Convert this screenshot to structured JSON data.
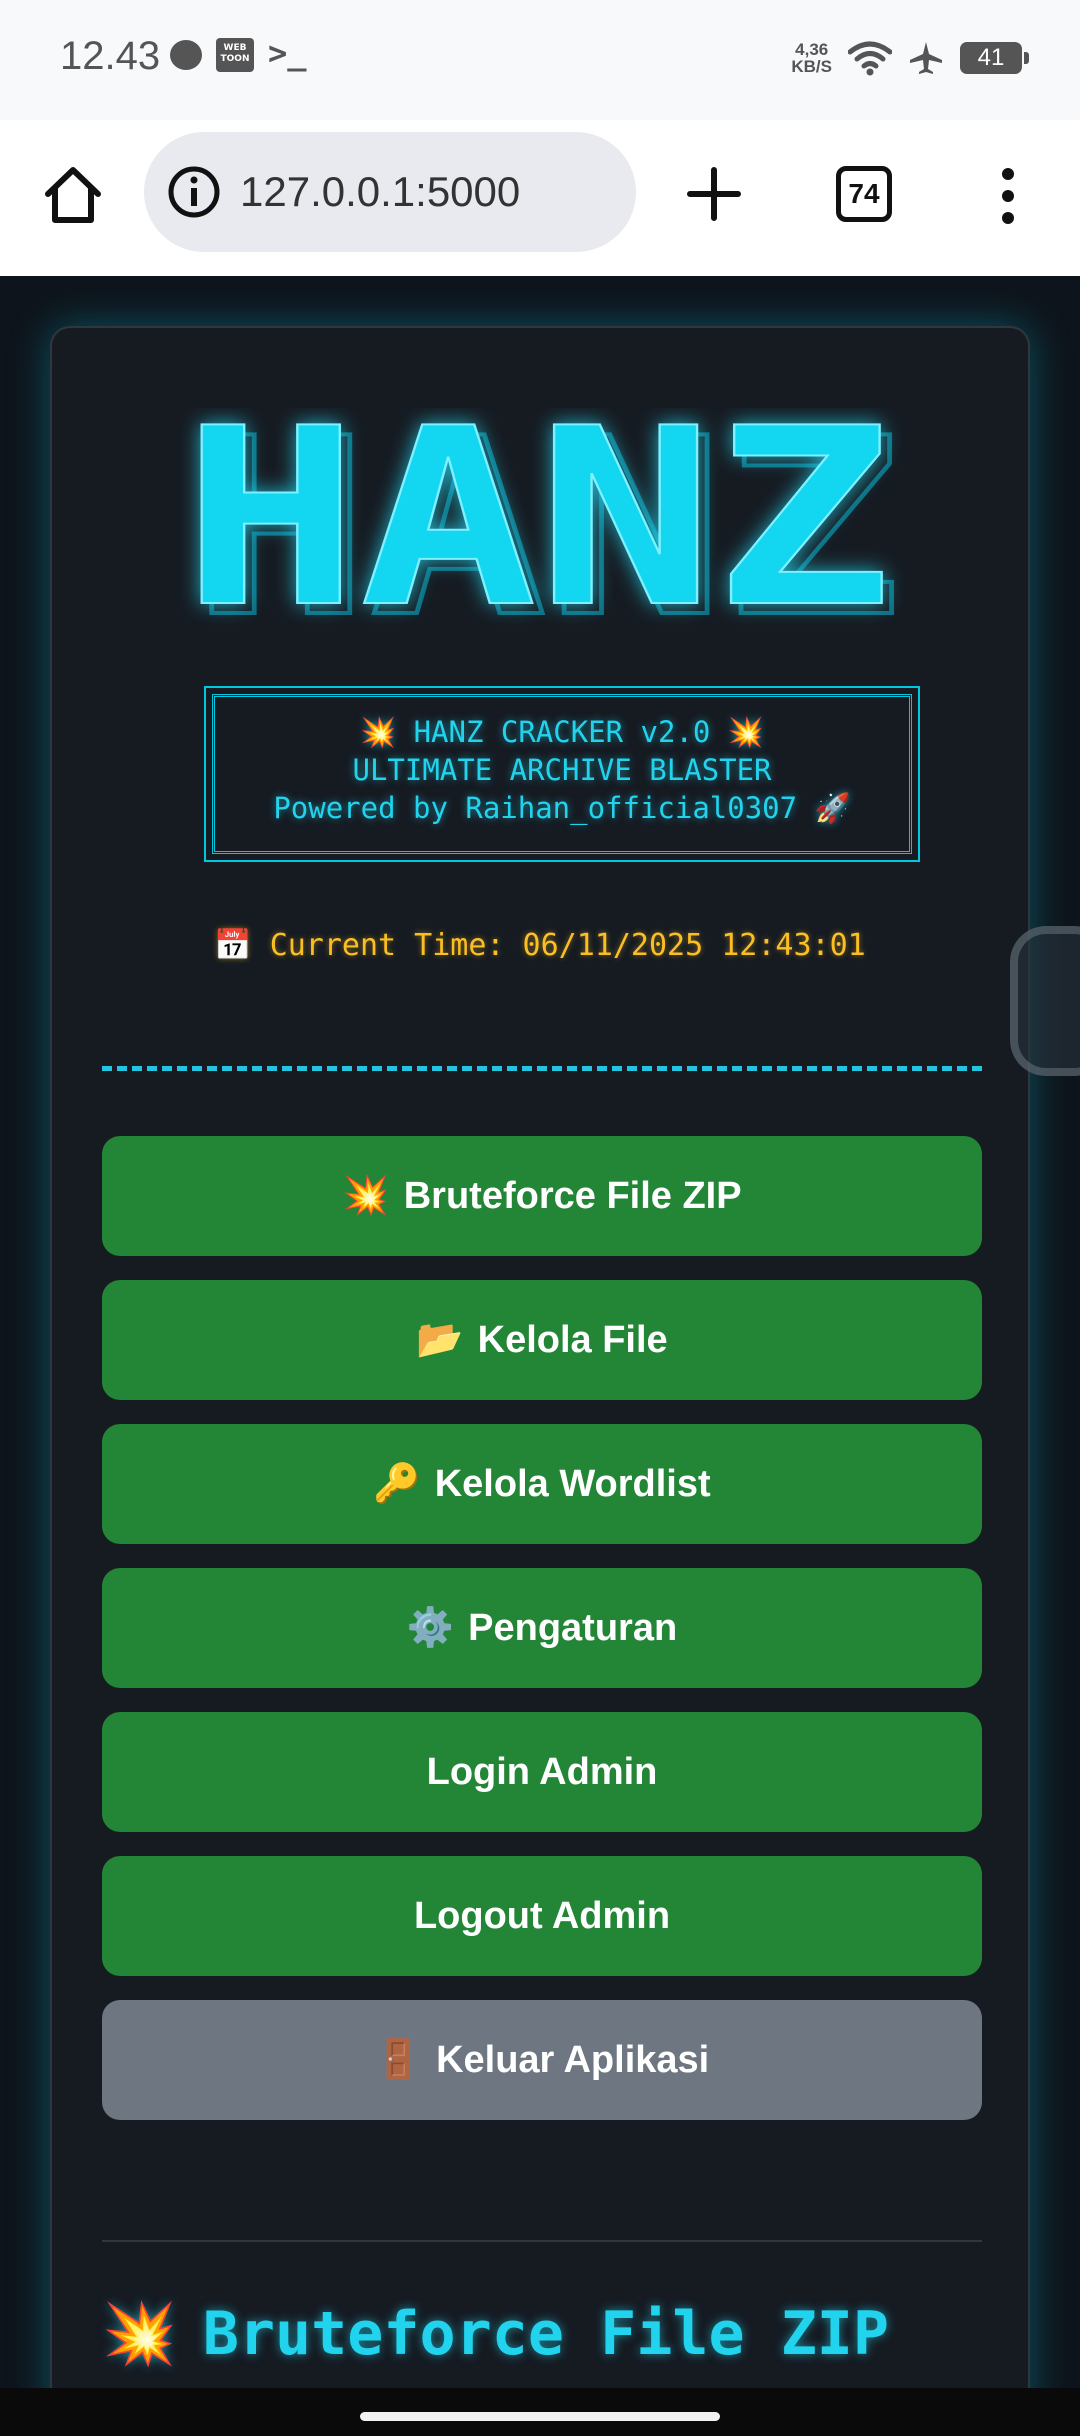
{
  "status_bar": {
    "time": "12.43",
    "speed_value": "4,36",
    "speed_unit": "KB/S",
    "battery": "41",
    "left_icons": [
      "message-icon",
      "webtoon-icon",
      "terminal-icon"
    ],
    "right_icons": [
      "wifi-icon",
      "airplane-icon",
      "battery-icon"
    ],
    "webtoon_label": "WEB TOON",
    "terminal_glyph": ">_"
  },
  "browser": {
    "url": "127.0.0.1:5000",
    "tab_count": "74",
    "icons": [
      "home-icon",
      "info-icon",
      "plus-icon",
      "tabs-icon",
      "more-vert-icon"
    ]
  },
  "header": {
    "logo_text": "HANZ",
    "banner_line1": "💥 HANZ CRACKER v2.0 💥",
    "banner_line2": "ULTIMATE ARCHIVE BLASTER",
    "banner_line3": "Powered by Raihan_official0307 🚀",
    "time_icon": "📅",
    "time_label": "Current Time: 06/11/2025 12:43:01"
  },
  "menu": {
    "buttons": [
      {
        "emoji": "💥",
        "label": "Bruteforce File ZIP"
      },
      {
        "emoji": "📂",
        "label": "Kelola File"
      },
      {
        "emoji": "🔑",
        "label": "Kelola Wordlist"
      },
      {
        "emoji": "⚙️",
        "label": "Pengaturan"
      },
      {
        "emoji": "",
        "label": "Login Admin"
      },
      {
        "emoji": "",
        "label": "Logout Admin"
      },
      {
        "emoji": "🚪",
        "label": "Keluar Aplikasi"
      }
    ]
  },
  "section": {
    "emoji": "💥",
    "title": "Bruteforce File ZIP"
  },
  "colors": {
    "accent": "#22d3ee",
    "button_green": "#238636",
    "button_gray": "#6e7681",
    "time_text": "#fbbf24",
    "background": "#0e141b"
  }
}
